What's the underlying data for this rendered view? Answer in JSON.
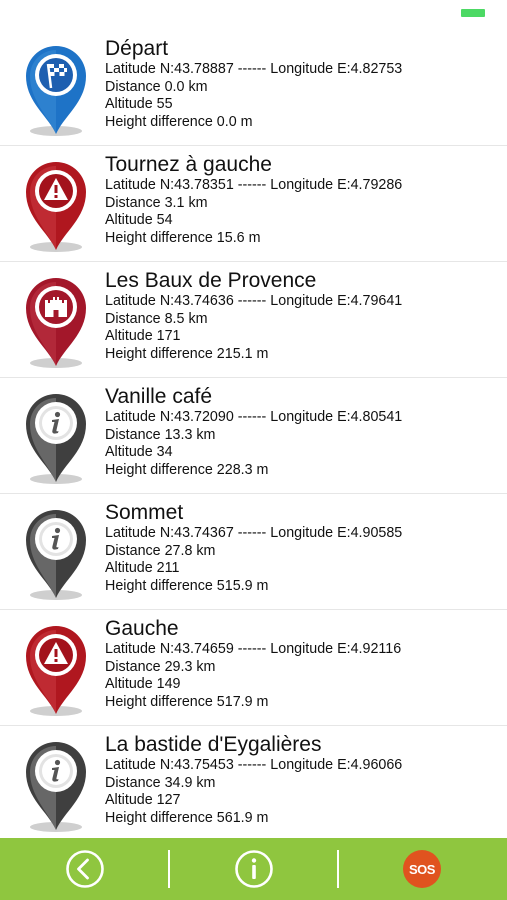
{
  "status_bar": {
    "battery_color": "#4cd964"
  },
  "waypoints": [
    {
      "icon": "start-flag-icon",
      "color": "#1e73c7",
      "title": "Départ",
      "coords": "Latitude N:43.78887 ------ Longitude E:4.82753",
      "distance": "Distance 0.0 km",
      "altitude": "Altitude 55",
      "height": "Height difference 0.0 m"
    },
    {
      "icon": "warning-icon",
      "color": "#b0171f",
      "title": "Tournez à gauche",
      "coords": "Latitude N:43.78351 ------ Longitude E:4.79286",
      "distance": "Distance 3.1 km",
      "altitude": "Altitude 54",
      "height": "Height difference 15.6 m"
    },
    {
      "icon": "castle-icon",
      "color": "#a3172a",
      "title": "Les Baux de Provence",
      "coords": "Latitude N:43.74636 ------ Longitude E:4.79641",
      "distance": "Distance 8.5 km",
      "altitude": "Altitude 171",
      "height": "Height difference 215.1 m"
    },
    {
      "icon": "info-icon",
      "color": "#555555",
      "title": "Vanille café",
      "coords": "Latitude N:43.72090 ------ Longitude E:4.80541",
      "distance": "Distance 13.3 km",
      "altitude": "Altitude 34",
      "height": "Height difference 228.3 m"
    },
    {
      "icon": "info-icon",
      "color": "#555555",
      "title": "Sommet",
      "coords": "Latitude N:43.74367 ------ Longitude E:4.90585",
      "distance": "Distance 27.8 km",
      "altitude": "Altitude 211",
      "height": "Height difference 515.9 m"
    },
    {
      "icon": "warning-icon",
      "color": "#b0171f",
      "title": "Gauche",
      "coords": "Latitude N:43.74659 ------ Longitude E:4.92116",
      "distance": "Distance 29.3 km",
      "altitude": "Altitude 149",
      "height": "Height difference 517.9 m"
    },
    {
      "icon": "info-icon",
      "color": "#555555",
      "title": "La bastide d'Eygalières",
      "coords": "Latitude N:43.75453 ------ Longitude E:4.96066",
      "distance": "Distance 34.9 km",
      "altitude": "Altitude 127",
      "height": "Height difference 561.9 m"
    }
  ],
  "tab_bar": {
    "background": "#8fc63f",
    "back_icon": "back-arrow-icon",
    "info_icon": "info-icon",
    "sos_label": "SOS",
    "sos_color": "#e0531f"
  }
}
